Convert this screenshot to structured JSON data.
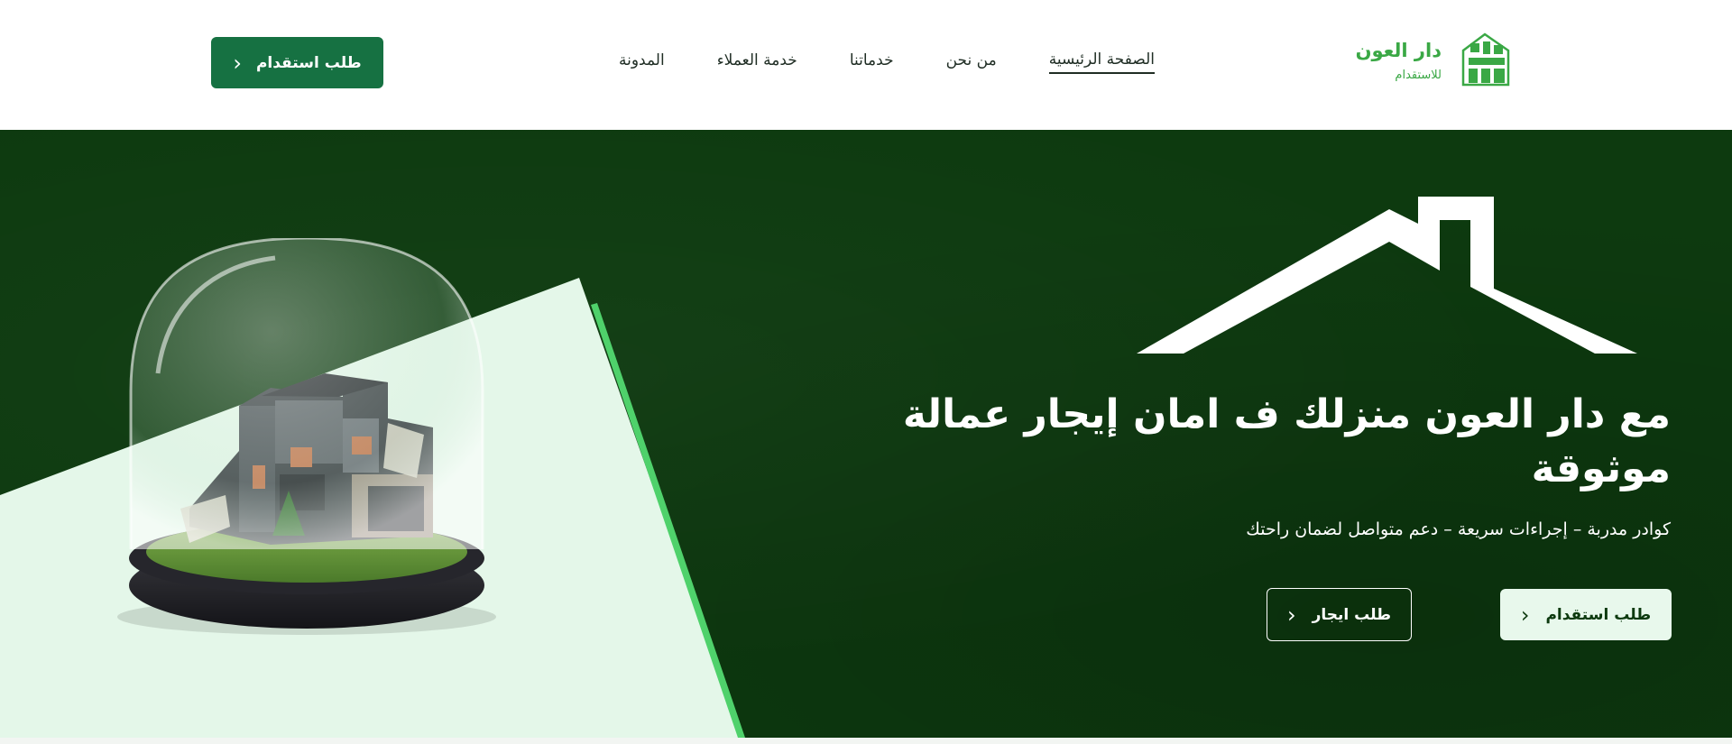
{
  "brand": {
    "name": "دار العون",
    "tagline": "للاستقدام",
    "mark_text": "دار العون",
    "accent_color": "#3aa845"
  },
  "nav": {
    "items": [
      {
        "label": "الصفحة الرئيسية",
        "active": true
      },
      {
        "label": "من نحن",
        "active": false
      },
      {
        "label": "خدماتنا",
        "active": false
      },
      {
        "label": "خدمة العملاء",
        "active": false
      },
      {
        "label": "المدونة",
        "active": false
      }
    ]
  },
  "header_cta": {
    "label": "طلب استقدام",
    "icon": "chevron-left-icon"
  },
  "hero": {
    "title": "مع دار العون منزلك ف امان إيجار عمالة موثوقة",
    "subtitle": "كوادر مدربة – إجراءات سريعة – دعم متواصل لضمان راحتك",
    "primary_button": {
      "label": "طلب استقدام",
      "icon": "chevron-left-icon"
    },
    "secondary_button": {
      "label": "طلب ايجار",
      "icon": "chevron-left-icon"
    },
    "background_color": "#0d3a0f",
    "panel_color": "#e4f7e9",
    "panel_edge_color": "#4fd16b"
  },
  "colors": {
    "header_button": "#167142",
    "text_dark": "#1f2d24"
  }
}
